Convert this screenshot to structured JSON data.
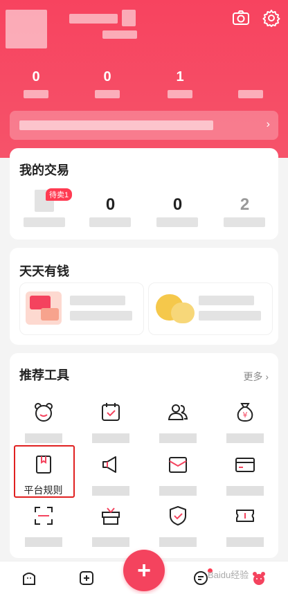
{
  "header": {
    "camera_icon": "camera-icon",
    "settings_icon": "gear-icon"
  },
  "stats": [
    {
      "value": "0"
    },
    {
      "value": "0"
    },
    {
      "value": "1"
    },
    {
      "value": ""
    }
  ],
  "my_trade": {
    "title": "我的交易",
    "items": [
      {
        "badge": "待卖1",
        "value": ""
      },
      {
        "badge": "",
        "value": "0"
      },
      {
        "badge": "",
        "value": "0"
      },
      {
        "badge": "",
        "value": "2"
      }
    ]
  },
  "daily_money": {
    "title": "天天有钱"
  },
  "tools": {
    "title": "推荐工具",
    "more": "更多",
    "items": [
      {
        "icon": "bear-face-icon",
        "label": ""
      },
      {
        "icon": "calendar-check-icon",
        "label": ""
      },
      {
        "icon": "users-icon",
        "label": ""
      },
      {
        "icon": "money-bag-icon",
        "label": ""
      },
      {
        "icon": "rule-book-icon",
        "label": "平台规则"
      },
      {
        "icon": "megaphone-icon",
        "label": ""
      },
      {
        "icon": "envelope-icon",
        "label": ""
      },
      {
        "icon": "credit-card-icon",
        "label": ""
      },
      {
        "icon": "scan-icon",
        "label": ""
      },
      {
        "icon": "gift-box-icon",
        "label": ""
      },
      {
        "icon": "shield-check-icon",
        "label": ""
      },
      {
        "icon": "ticket-icon",
        "label": ""
      }
    ]
  },
  "tabbar": {
    "fab_label": "+",
    "tabs": [
      {
        "icon": "home-icon"
      },
      {
        "icon": "add-square-icon"
      },
      {
        "icon": "message-icon"
      },
      {
        "icon": "profile-icon"
      }
    ]
  },
  "watermark": "Baidu经验",
  "colors": {
    "brand": "#f4435e",
    "highlight": "#e02020"
  }
}
